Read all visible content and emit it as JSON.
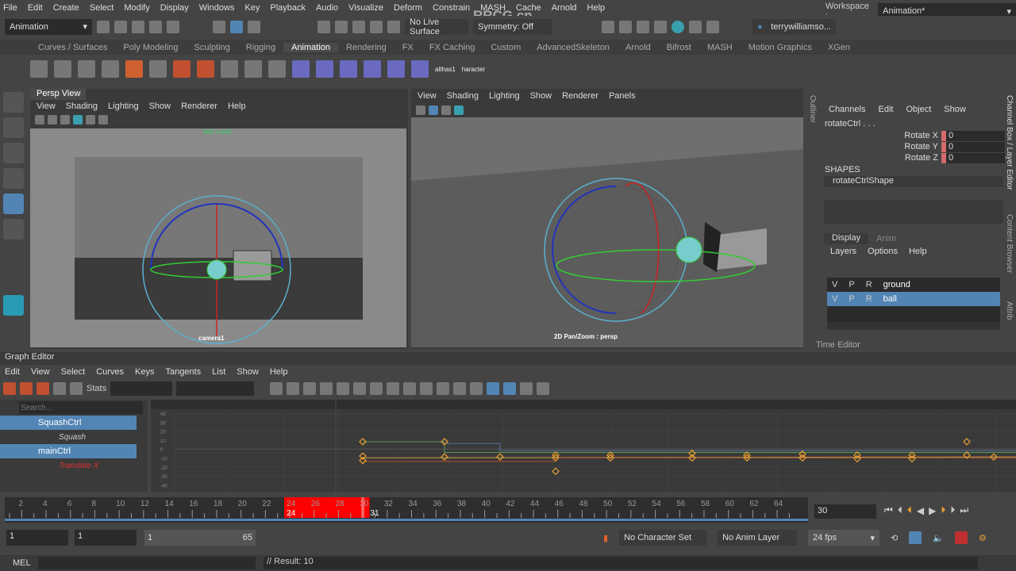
{
  "menubar": [
    "File",
    "Edit",
    "Create",
    "Select",
    "Modify",
    "Display",
    "Windows",
    "Key",
    "Playback",
    "Audio",
    "Visualize",
    "Deform",
    "Constrain",
    "MASH",
    "Cache",
    "Arnold",
    "Help"
  ],
  "workspace": {
    "label": "Workspace :",
    "value": "Animation*"
  },
  "status": {
    "mode": "Animation",
    "live_surface": "No Live Surface",
    "symmetry": "Symmetry: Off",
    "user": "terrywilliamso..."
  },
  "shelf_tabs": [
    "Curves / Surfaces",
    "Poly Modeling",
    "Sculpting",
    "Rigging",
    "Animation",
    "Rendering",
    "FX",
    "FX Caching",
    "Custom",
    "AdvancedSkeleton",
    "Arnold",
    "Bifrost",
    "MASH",
    "Motion Graphics",
    "XGen"
  ],
  "shelf_active": "Animation",
  "shelf_labels": [
    "althas1",
    "haracter"
  ],
  "viewport1": {
    "title": "Persp View",
    "menu": [
      "View",
      "Shading",
      "Lighting",
      "Show",
      "Renderer",
      "Help"
    ],
    "resolution": "960 x 540",
    "camera": "camera1"
  },
  "viewport2": {
    "menu": [
      "View",
      "Shading",
      "Lighting",
      "Show",
      "Renderer",
      "Panels"
    ],
    "camera": "2D Pan/Zoom : persp"
  },
  "outliner_tab": "Outliner",
  "channel_box": {
    "menu": [
      "Channels",
      "Edit",
      "Object",
      "Show"
    ],
    "object": "rotateCtrl . . .",
    "attrs": [
      {
        "name": "Rotate X",
        "value": "0"
      },
      {
        "name": "Rotate Y",
        "value": "0"
      },
      {
        "name": "Rotate Z",
        "value": "0"
      }
    ],
    "shapes_label": "SHAPES",
    "shape": "rotateCtrlShape"
  },
  "layer_editor": {
    "tabs": [
      "Display",
      "Anim"
    ],
    "menu": [
      "Layers",
      "Options",
      "Help"
    ],
    "layers": [
      {
        "v": "V",
        "p": "P",
        "r": "R",
        "name": "ground"
      },
      {
        "v": "V",
        "p": "P",
        "r": "R",
        "name": "ball"
      }
    ]
  },
  "right_tabs": [
    "Channel Box / Layer Editor",
    "Content Browser",
    "Attrib"
  ],
  "time_editor": "Time Editor",
  "graph_editor": {
    "title": "Graph Editor",
    "menu": [
      "Edit",
      "View",
      "Select",
      "Curves",
      "Keys",
      "Tangents",
      "List",
      "Show",
      "Help"
    ],
    "stats_label": "Stats",
    "search_placeholder": "Search...",
    "outliner": [
      {
        "name": "SquashCtrl",
        "type": "node"
      },
      {
        "name": "Squash",
        "type": "attr"
      },
      {
        "name": "mainCtrl",
        "type": "node"
      },
      {
        "name": "Translate X",
        "type": "attr"
      }
    ],
    "y_ticks": [
      "40",
      "30",
      "20",
      "10",
      "0",
      "-10",
      "-20",
      "-30",
      "-40"
    ]
  },
  "timeslider": {
    "ticks": [
      "2",
      "4",
      "6",
      "8",
      "10",
      "12",
      "14",
      "16",
      "18",
      "20",
      "22",
      "24",
      "26",
      "28",
      "30",
      "32",
      "34",
      "36",
      "38",
      "40",
      "42",
      "44",
      "46",
      "48",
      "50",
      "52",
      "54",
      "56",
      "58",
      "60",
      "62",
      "64"
    ],
    "range_start": "24",
    "range_end": "31",
    "current_frame": "30",
    "selection_color": "#ff0000"
  },
  "range": {
    "start": "1",
    "inner_start": "1",
    "slider_start": "1",
    "slider_end": "65"
  },
  "playback": {
    "character_set": "No Character Set",
    "anim_layer": "No Anim Layer",
    "fps": "24 fps"
  },
  "command": {
    "lang": "MEL",
    "result": "// Result: 10"
  },
  "watermark": "RRCG.cn",
  "colors": {
    "accent": "#5285b4",
    "key": "#e8a030"
  }
}
